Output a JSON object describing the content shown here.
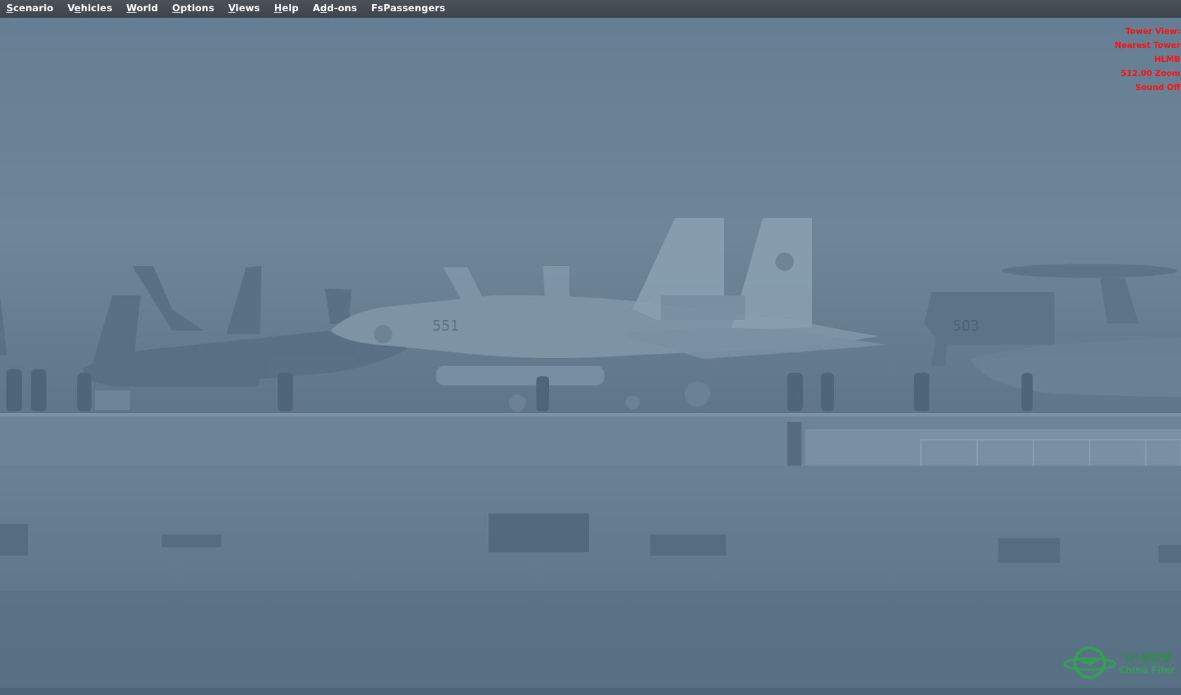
{
  "menubar": {
    "items": [
      {
        "pre": "",
        "ul": "S",
        "post": "cenario"
      },
      {
        "pre": "V",
        "ul": "e",
        "post": "hicles"
      },
      {
        "pre": "",
        "ul": "W",
        "post": "orld"
      },
      {
        "pre": "",
        "ul": "O",
        "post": "ptions"
      },
      {
        "pre": "",
        "ul": "V",
        "post": "iews"
      },
      {
        "pre": "",
        "ul": "H",
        "post": "elp"
      },
      {
        "pre": "A",
        "ul": "d",
        "post": "d-ons"
      },
      {
        "pre": "FsPassengers",
        "ul": "",
        "post": ""
      }
    ]
  },
  "view_info": {
    "view_type": "Tower View:",
    "view_name": "Nearest Tower",
    "airport_code": "HLMB",
    "zoom": "512.00 Zoom",
    "sound": "Sound Off"
  },
  "scene": {
    "aircraft_number_center": "551",
    "aircraft_number_right": "503",
    "fog_color": "#6b8296",
    "deck_color": "#5d7488"
  },
  "watermark": {
    "text_cn": "飞行者联盟",
    "text_en": "China Flier",
    "color": "#2ea84a"
  }
}
